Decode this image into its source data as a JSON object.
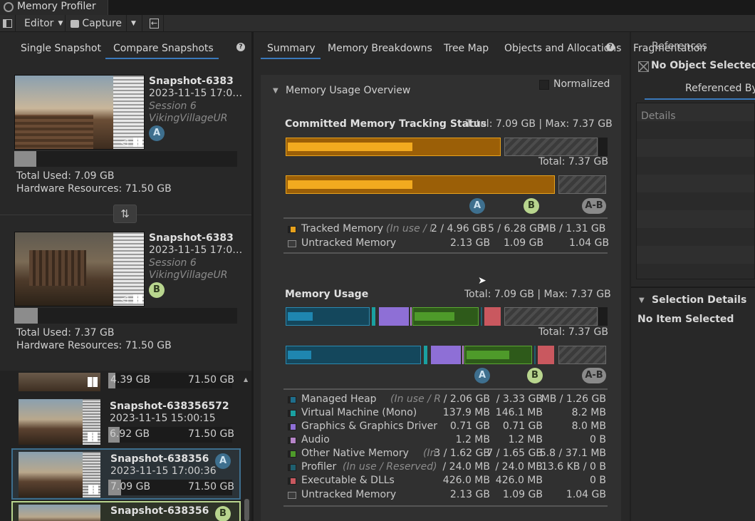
{
  "window": {
    "title": "Memory Profiler"
  },
  "toolbar": {
    "editor_label": "Editor",
    "capture_label": "Capture"
  },
  "left_tabs": {
    "single": "Single Snapshot",
    "compare": "Compare Snapshots"
  },
  "snapshot_a": {
    "name": "Snapshot-6383",
    "date": "2023-11-15 17:0…",
    "session": "Session 6",
    "project": "VikingVillageUR",
    "badge": "A",
    "total_used": "Total Used: 7.09 GB",
    "hardware": "Hardware Resources: 71.50 GB"
  },
  "snapshot_b": {
    "name": "Snapshot-6383",
    "date": "2023-11-15 17:0…",
    "session": "Session 6",
    "project": "VikingVillageUR",
    "badge": "B",
    "total_used": "Total Used: 7.37 GB",
    "hardware": "Hardware Resources: 71.50 GB"
  },
  "snapshot_list": [
    {
      "name": "",
      "date": "",
      "used": "4.39 GB",
      "hw": "71.50 GB",
      "badge": ""
    },
    {
      "name": "Snapshot-638356572",
      "date": "2023-11-15 15:00:15",
      "used": "6.92 GB",
      "hw": "71.50 GB",
      "badge": ""
    },
    {
      "name": "Snapshot-638356",
      "date": "2023-11-15 17:00:36",
      "used": "7.09 GB",
      "hw": "71.50 GB",
      "badge": "A"
    },
    {
      "name": "Snapshot-638356",
      "date": "",
      "used": "",
      "hw": "",
      "badge": "B"
    }
  ],
  "main_tabs": [
    "Summary",
    "Memory Breakdowns",
    "Tree Map",
    "Objects and Allocations",
    "Fragmentation"
  ],
  "overview": {
    "title": "Memory Usage Overview",
    "normalized_label": "Normalized",
    "committed_title": "Committed Memory Tracking Status",
    "committed_total": "Total: 7.09 GB | Max: 7.37 GB",
    "bar_a_total": "Total: 7.37 GB",
    "badges": [
      "A",
      "B",
      "A-B"
    ],
    "rows": [
      {
        "label": "Tracked Memory",
        "sub": "(In use / R",
        "a": "2 / 4.96 GB",
        "b": "5 / 6.28 GB",
        "d": "MB / 1.31 GB",
        "color": "#e8a21c"
      },
      {
        "label": "Untracked Memory",
        "sub": "",
        "a": "2.13 GB",
        "b": "1.09 GB",
        "d": "1.04 GB",
        "color": "#3a3a3a"
      }
    ]
  },
  "usage": {
    "title": "Memory Usage",
    "total": "Total: 7.09 GB | Max: 7.37 GB",
    "bar_total": "Total: 7.37 GB",
    "rows": [
      {
        "label": "Managed Heap",
        "sub": "(In use / Rese",
        "a": "/ 2.06 GB",
        "b": "/ 3.33 GB",
        "d": "MB / 1.26 GB",
        "color": "#1f6e8c"
      },
      {
        "label": "Virtual Machine (Mono)",
        "sub": "",
        "a": "137.9 MB",
        "b": "146.1 MB",
        "d": "8.2 MB",
        "color": "#1aa0a0"
      },
      {
        "label": "Graphics & Graphics Driver",
        "sub": "",
        "a": "0.71 GB",
        "b": "0.71 GB",
        "d": "8.0 MB",
        "color": "#8e6fd6"
      },
      {
        "label": "Audio",
        "sub": "",
        "a": "1.2 MB",
        "b": "1.2 MB",
        "d": "0 B",
        "color": "#b785c9"
      },
      {
        "label": "Other Native Memory",
        "sub": "(In use",
        "a": "3 / 1.62 GB",
        "b": "7 / 1.65 GB",
        "d": "5.8 / 37.1 MB",
        "color": "#4e9a2a"
      },
      {
        "label": "Profiler",
        "sub": "(In use / Reserved)",
        "a": "/ 24.0 MB",
        "b": "/ 24.0 MB",
        "d": "13.6 KB / 0 B",
        "color": "#1f5f6e"
      },
      {
        "label": "Executable & DLLs",
        "sub": "",
        "a": "426.0 MB",
        "b": "426.0 MB",
        "d": "0 B",
        "color": "#c9585f"
      },
      {
        "label": "Untracked Memory",
        "sub": "",
        "a": "2.13 GB",
        "b": "1.09 GB",
        "d": "1.04 GB",
        "color": "#3a3a3a"
      }
    ]
  },
  "right": {
    "references_label": "References",
    "no_object": "No Object Selected",
    "referenced_by": "Referenced By",
    "details_label": "Details",
    "selection_details": "Selection Details",
    "no_item": "No Item Selected"
  },
  "colors": {
    "accent": "#3a79bb",
    "tracked": "#e8a21c",
    "managed": "#1f6e8c",
    "native": "#4e9a2a"
  }
}
